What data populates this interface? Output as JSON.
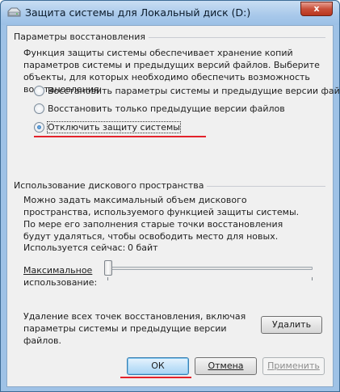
{
  "window": {
    "title": "Защита системы для Локальный диск (D:)",
    "close_label": "x"
  },
  "restore_group": {
    "title": "Параметры восстановления",
    "description": "Функция защиты системы обеспечивает хранение копий параметров системы и предыдущих версий файлов. Выберите объекты, для которых необходимо обеспечить возможность восстановления:",
    "options": [
      {
        "label": "Восстановить параметры системы и предыдущие версии файлов",
        "selected": false
      },
      {
        "label": "Восстановить только предыдущие версии файлов",
        "selected": false
      },
      {
        "label": "Отключить защиту системы",
        "selected": true
      }
    ]
  },
  "disk_group": {
    "title": "Использование дискового пространства",
    "description": "Можно задать максимальный объем дискового пространства, используемого функцией защиты системы. По мере его заполнения старые точки восстановления будут удаляться, чтобы освободить место для новых.",
    "used_label": "Используется сейчас:",
    "used_value": "0 байт",
    "max_label_line1": "Максимальное",
    "max_label_line2": "использование:",
    "slider_level": 0,
    "delete_description": "Удаление всех точек восстановления, включая параметры системы и предыдущие версии файлов.",
    "delete_button": "Удалить"
  },
  "buttons": {
    "ok": "ОК",
    "cancel": "Отмена",
    "apply": "Применить"
  },
  "colors": {
    "annotation_red": "#e3222b",
    "default_button_border": "#3c7fb1"
  }
}
